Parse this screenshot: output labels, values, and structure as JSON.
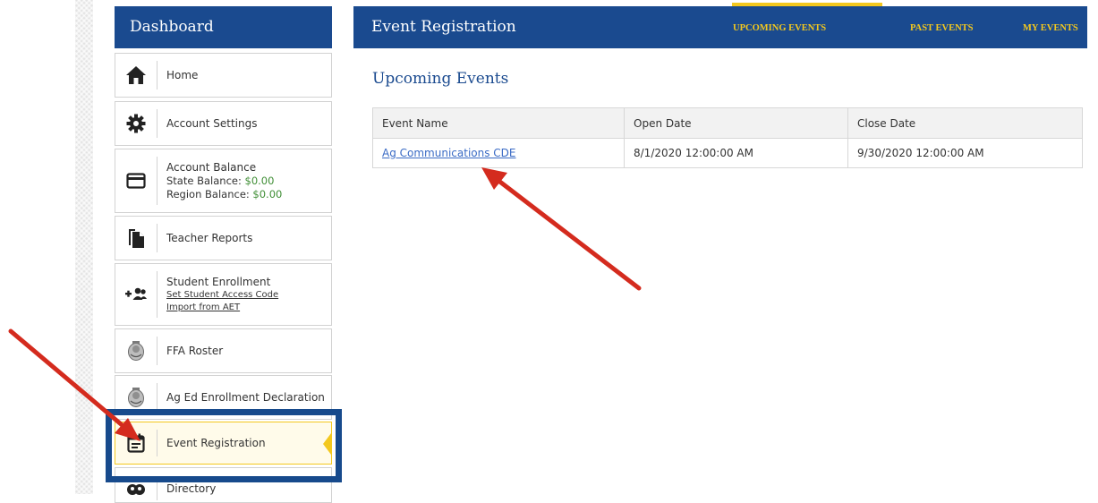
{
  "sidebar": {
    "title": "Dashboard",
    "items": [
      {
        "icon": "home-icon",
        "label": "Home"
      },
      {
        "icon": "gear-icon",
        "label": "Account Settings"
      },
      {
        "icon": "credit-card-icon",
        "label": "Account Balance",
        "state_label": "State Balance:",
        "state_value": "$0.00",
        "region_label": "Region Balance:",
        "region_value": "$0.00"
      },
      {
        "icon": "document-icon",
        "label": "Teacher Reports"
      },
      {
        "icon": "add-users-icon",
        "label": "Student Enrollment",
        "link1": "Set Student Access Code",
        "link2": "Import from AET"
      },
      {
        "icon": "ffa-emblem-icon",
        "label": "FFA Roster"
      },
      {
        "icon": "ffa-emblem-icon",
        "label": "Ag Ed Enrollment Declaration"
      },
      {
        "icon": "calendar-icon",
        "label": "Event Registration",
        "active": true
      },
      {
        "icon": "directory-icon",
        "label": "Directory"
      }
    ]
  },
  "header": {
    "title": "Event Registration",
    "tabs": [
      {
        "label": "UPCOMING EVENTS",
        "active": true
      },
      {
        "label": "PAST EVENTS",
        "active": false
      },
      {
        "label": "MY EVENTS",
        "active": false
      }
    ]
  },
  "main": {
    "section_title": "Upcoming Events",
    "table": {
      "headers": [
        "Event Name",
        "Open Date",
        "Close Date"
      ],
      "rows": [
        {
          "name": "Ag Communications CDE",
          "open": "8/1/2020 12:00:00 AM",
          "close": "9/30/2020 12:00:00 AM"
        }
      ]
    }
  },
  "colors": {
    "brand_blue": "#1a4a8f",
    "accent_gold": "#f3c81e",
    "annotation_red": "#d42b1e",
    "money_green": "#3f8e35"
  }
}
